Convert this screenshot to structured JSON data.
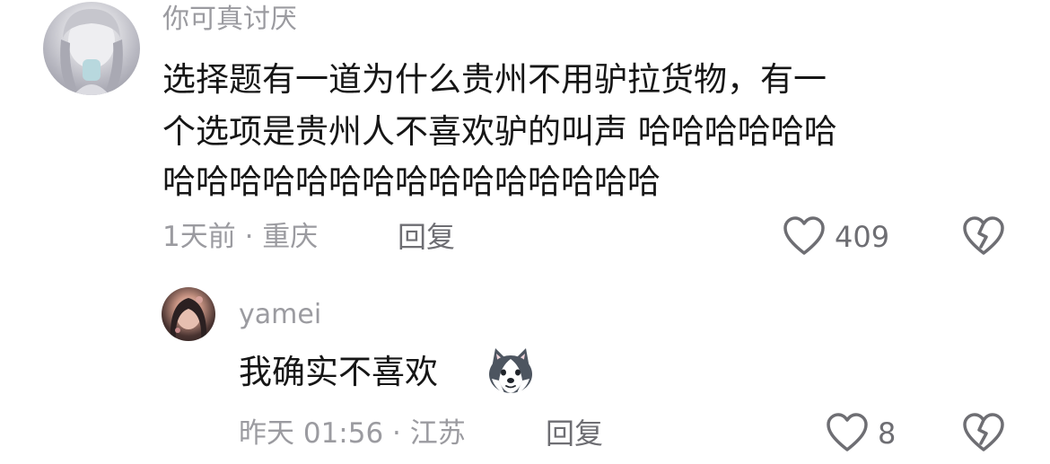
{
  "comment": {
    "username": "你可真讨厌",
    "text_lines": [
      "选择题有一道为什么贵州不用驴拉货物，有一",
      "个选项是贵州人不喜欢驴的叫声 哈哈哈哈哈哈",
      "哈哈哈哈哈哈哈哈哈哈哈哈哈哈哈"
    ],
    "meta": "1天前 · 重庆",
    "reply_label": "回复",
    "likes": "409"
  },
  "reply": {
    "username": "yamei",
    "text": "我确实不喜欢",
    "emoji_icon": "husky-dog-icon",
    "meta": "昨天 01:56 · 江苏",
    "reply_label": "回复",
    "likes": "8"
  },
  "icons": {
    "like": "heart-outline-icon",
    "dislike": "broken-heart-icon"
  },
  "colors": {
    "text": "#161616",
    "muted": "#9b9ba0",
    "icon": "#6e6e73",
    "background": "#ffffff"
  }
}
